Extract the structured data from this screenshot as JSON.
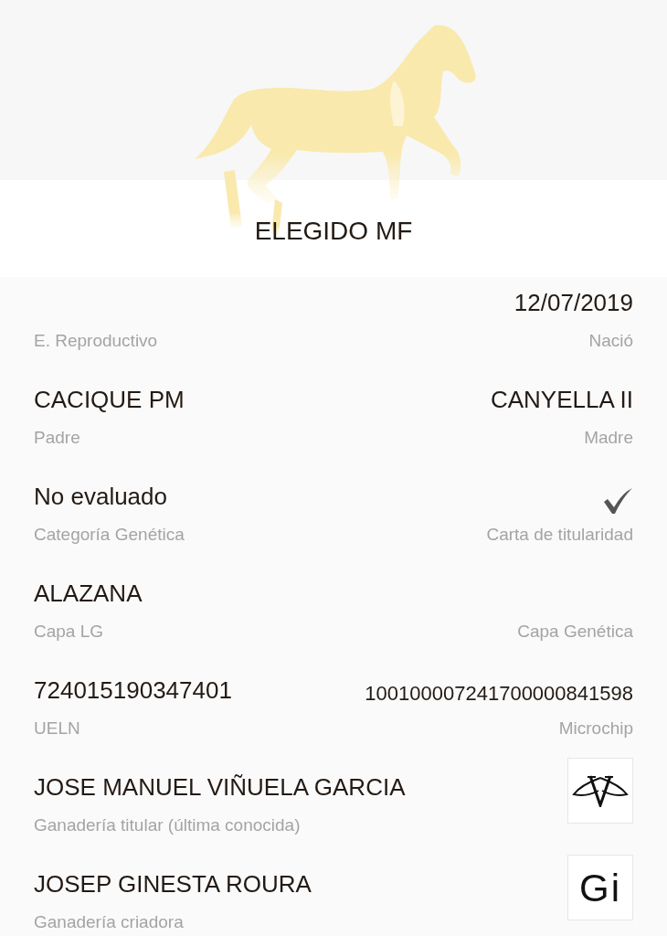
{
  "header": {
    "name": "ELEGIDO MF"
  },
  "rows": [
    {
      "left": {
        "label": "E. Reproductivo"
      },
      "right": {
        "kind": "text",
        "value": "12/07/2019",
        "label": "Nació"
      }
    },
    {
      "left": {
        "value": "CACIQUE PM",
        "label": "Padre"
      },
      "right": {
        "kind": "text",
        "value": "CANYELLA II",
        "label": "Madre"
      }
    },
    {
      "left": {
        "value": "No evaluado",
        "label": "Categoría Genética"
      },
      "right": {
        "kind": "check",
        "checked": true,
        "label": "Carta de titularidad"
      }
    },
    {
      "left": {
        "value": "ALAZANA",
        "label": "Capa LG"
      },
      "right": {
        "kind": "text",
        "label": "Capa Genética"
      }
    },
    {
      "left": {
        "value": "724015190347401",
        "label": "UELN"
      },
      "right": {
        "kind": "text",
        "value": "100100007241700000841598",
        "label": "Microchip",
        "small": true
      }
    },
    {
      "left": {
        "value": "JOSE MANUEL VIÑUELA GARCIA",
        "label": "Ganadería titular (última conocida)"
      },
      "right": {
        "kind": "wings_logo"
      }
    },
    {
      "left": {
        "value": "JOSEP GINESTA ROURA",
        "label": "Ganadería criadora"
      },
      "right": {
        "kind": "letters_logo",
        "logo_text": "Gi"
      }
    }
  ]
}
